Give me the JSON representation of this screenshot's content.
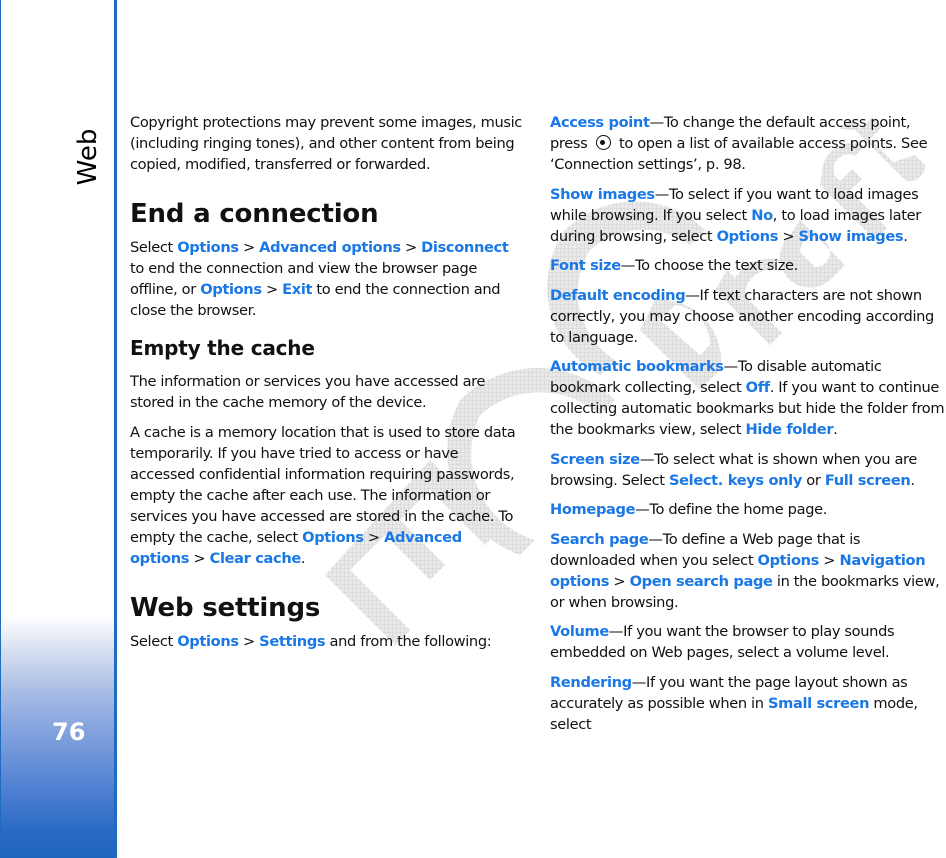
{
  "sidebar": {
    "section_title": "Web",
    "page_number": "76"
  },
  "colors": {
    "link": "#1a78e6",
    "sidebar_accent": "#1f6bc0",
    "watermark": "#c8c8c8"
  },
  "watermark": {
    "text": "FCC Draft",
    "icon": "hatched-watermark"
  },
  "left_column": {
    "intro": "Copyright protections may prevent some images, music (including ringing tones), and other content from being copied, modified, transferred or forwarded.",
    "end_connection": {
      "heading": "End a connection",
      "p1": {
        "t1": "Select ",
        "l1": "Options",
        "sep1": " > ",
        "l2": "Advanced options",
        "sep2": " > ",
        "l3": "Disconnect",
        "t2": " to end the connection and view the browser page offline, or ",
        "l4": "Options",
        "sep3": " > ",
        "l5": "Exit",
        "t3": " to end the connection and close the browser."
      }
    },
    "empty_cache": {
      "heading": "Empty the cache",
      "p1": "The information or services you have accessed are stored in the cache memory of the device.",
      "p2": {
        "t1": "A cache is a memory location that is used to store data temporarily. If you have tried to access or have accessed confidential information requiring passwords, empty the cache after each use. The information or services you have accessed are stored in the cache. To empty the cache, select ",
        "l1": "Options",
        "sep1": " > ",
        "l2": "Advanced options",
        "sep2": " > ",
        "l3": "Clear cache",
        "t2": "."
      }
    },
    "web_settings": {
      "heading": "Web settings",
      "p1": {
        "t1": "Select ",
        "l1": "Options",
        "sep1": " > ",
        "l2": "Settings",
        "t2": " and from the following:"
      }
    }
  },
  "right_column": {
    "access_point": {
      "term": "Access point",
      "t1": "—To change the default access point, press ",
      "icon": "navigation-key-icon",
      "t2": " to open a list of available access points. See ‘Connection settings’, p. 98."
    },
    "show_images": {
      "term": "Show images",
      "t1": "—To select if you want to load images while browsing. If you select ",
      "l1": "No",
      "t2": ", to load images later during browsing, select ",
      "l2": "Options",
      "sep1": " > ",
      "l3": "Show images",
      "t3": "."
    },
    "font_size": {
      "term": "Font size",
      "t1": "—To choose the text size."
    },
    "default_encoding": {
      "term": "Default encoding",
      "t1": "—If text characters are not shown correctly, you may choose another encoding according to language."
    },
    "automatic_bookmarks": {
      "term": "Automatic bookmarks",
      "t1": "—To disable automatic bookmark collecting, select ",
      "l1": "Off",
      "t2": ". If you want to continue collecting automatic bookmarks but hide the folder from the bookmarks view, select ",
      "l2": "Hide folder",
      "t3": "."
    },
    "screen_size": {
      "term": "Screen size",
      "t1": "—To select what is shown when you are browsing. Select ",
      "l1": "Select. keys only",
      "t2": " or ",
      "l2": "Full screen",
      "t3": "."
    },
    "homepage": {
      "term": "Homepage",
      "t1": "—To define the home page."
    },
    "search_page": {
      "term": "Search page",
      "t1": "—To define a Web page that is downloaded when you select ",
      "l1": "Options",
      "sep1": " > ",
      "l2": "Navigation options",
      "sep2": " > ",
      "l3": "Open search page",
      "t2": " in the bookmarks view, or when browsing."
    },
    "volume": {
      "term": "Volume",
      "t1": "—If you want the browser to play sounds embedded on Web pages, select a volume level."
    },
    "rendering": {
      "term": "Rendering",
      "t1": "—If you want the page layout shown as accurately as possible when in ",
      "l1": "Small screen",
      "t2": " mode, select"
    }
  }
}
